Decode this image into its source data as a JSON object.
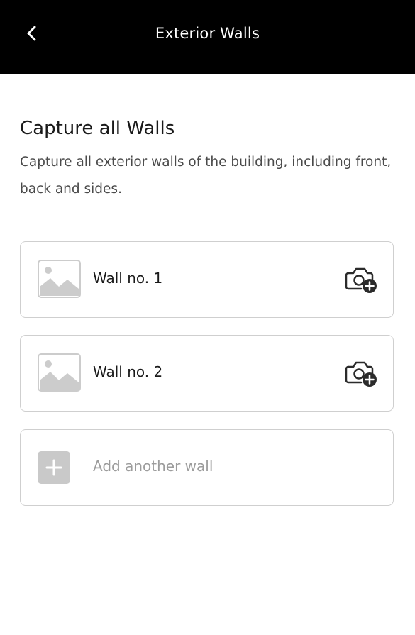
{
  "header": {
    "title": "Exterior Walls",
    "back_icon": "chevron-left-icon",
    "background": "#000000",
    "text_color": "#ffffff"
  },
  "section": {
    "title": "Capture all Walls",
    "description": "Capture all exterior walls of the building, including front, back and sides."
  },
  "walls": [
    {
      "label": "Wall no. 1",
      "thumbnail_icon": "image-placeholder-icon",
      "action_icon": "camera-add-icon"
    },
    {
      "label": "Wall no. 2",
      "thumbnail_icon": "image-placeholder-icon",
      "action_icon": "camera-add-icon"
    }
  ],
  "add_wall": {
    "label": "Add another wall",
    "icon": "plus-icon"
  },
  "colors": {
    "card_border": "#cfcfcf",
    "placeholder_gray": "#c9c9c9",
    "muted_text": "#9c9c9c"
  }
}
